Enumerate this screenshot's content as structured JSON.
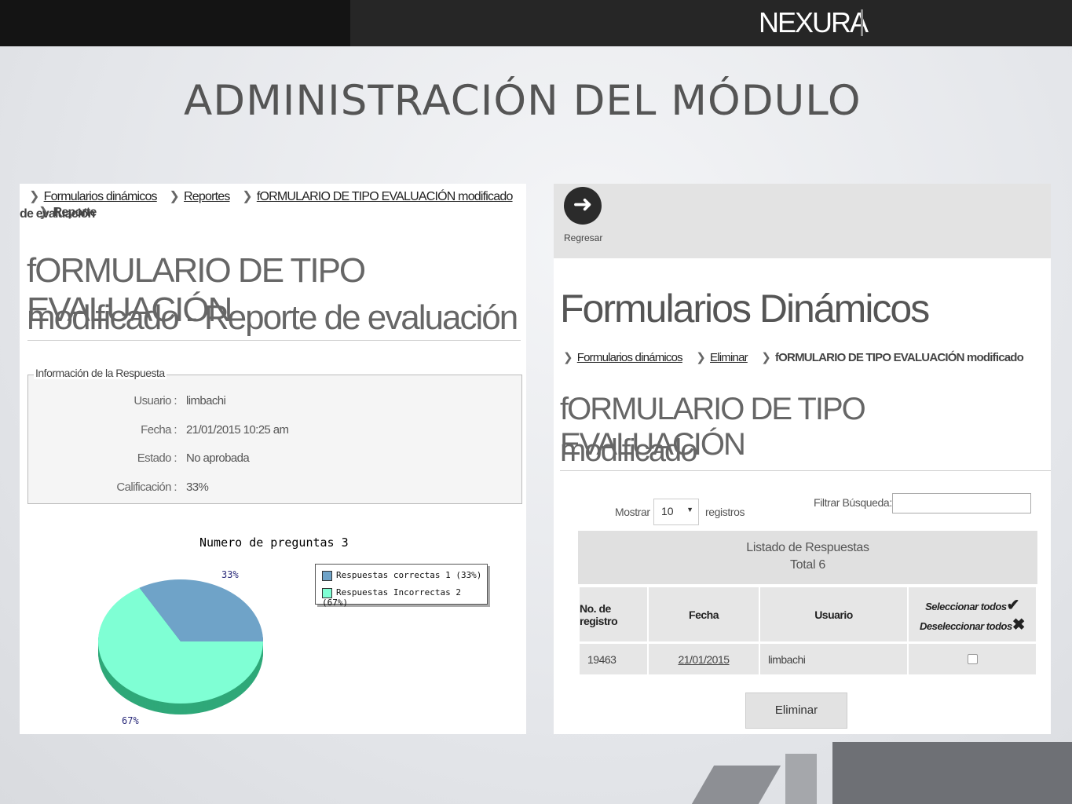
{
  "header": {
    "logo": "NEXURA"
  },
  "slide_title": "ADMINISTRACIÓN DEL MÓDULO",
  "left": {
    "breadcrumb": [
      "Formularios dinámicos",
      "Reportes",
      "fORMULARIO DE TIPO EVALUACIÓN modificado"
    ],
    "breadcrumb_current_1": "Reporte",
    "breadcrumb_current_2": "de evaluación",
    "title_line1": "fORMULARIO DE TIPO EVALUACIÓN",
    "title_line2": "modificado - Reporte de evaluación",
    "fieldset_legend": "Información de la Respuesta",
    "info": [
      {
        "label": "Usuario :",
        "value": "limbachi"
      },
      {
        "label": "Fecha :",
        "value": "21/01/2015 10:25 am"
      },
      {
        "label": "Estado :",
        "value": "No aprobada"
      },
      {
        "label": "Calificación :",
        "value": "33%"
      }
    ],
    "chart_title": "Numero de preguntas 3"
  },
  "chart_data": {
    "type": "pie",
    "title": "Numero de preguntas 3",
    "labels": [
      "Respuestas correctas 1 (33%)",
      "Respuestas Incorrectas 2 (67%)"
    ],
    "values": [
      1,
      2
    ],
    "percent_labels": [
      "33%",
      "67%"
    ],
    "colors": [
      "#6fa3c8",
      "#7fffd4"
    ]
  },
  "right": {
    "back_label": "Regresar",
    "page_title": "Formularios Dinámicos",
    "breadcrumb": [
      "Formularios dinámicos",
      "Eliminar"
    ],
    "breadcrumb_current": "fORMULARIO DE TIPO EVALUACIÓN modificado",
    "title_line1": "fORMULARIO DE TIPO EVALUACIÓN",
    "title_line2": "modificado",
    "show_label": "Mostrar",
    "show_value": "10",
    "records_label": "registros",
    "filter_label": "Filtrar Búsqueda:",
    "filter_value": "",
    "table_caption": "Listado de Respuestas",
    "table_total": "Total 6",
    "columns": [
      "No. de registro",
      "Fecha",
      "Usuario"
    ],
    "select_all": "Seleccionar todos",
    "deselect_all": "Deseleccionar todos",
    "rows": [
      {
        "id": "19463",
        "date": "21/01/2015",
        "user": "limbachi"
      }
    ],
    "delete_button": "Eliminar"
  }
}
